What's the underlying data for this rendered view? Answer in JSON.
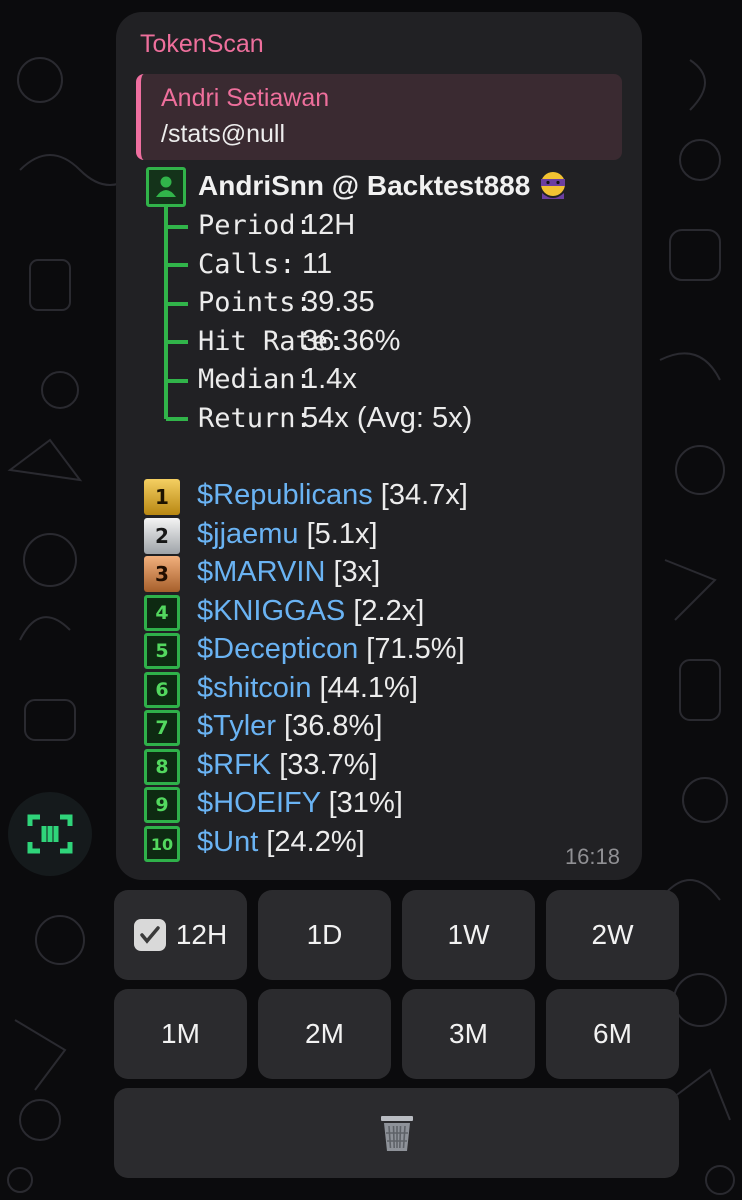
{
  "bubble": {
    "sender": "TokenScan",
    "reply": {
      "name": "Andri Setiawan",
      "text": "/stats@null"
    },
    "header": {
      "title": "AndriSnn @ Backtest888"
    },
    "stats": [
      {
        "label": "Period:",
        "value": "12H"
      },
      {
        "label": "Calls:",
        "value": "11"
      },
      {
        "label": "Points:",
        "value": "39.35"
      },
      {
        "label": "Hit Rate:",
        "value": "36.36%"
      },
      {
        "label": "Median:",
        "value": "1.4x"
      },
      {
        "label": "Return:",
        "value": "54x (Avg: 5x)"
      }
    ],
    "tokens": [
      {
        "rank": "1",
        "name": "$Republicans",
        "mult": "[34.7x]"
      },
      {
        "rank": "2",
        "name": "$jjaemu",
        "mult": "[5.1x]"
      },
      {
        "rank": "3",
        "name": "$MARVIN",
        "mult": "[3x]"
      },
      {
        "rank": "4",
        "name": "$KNIGGAS",
        "mult": "[2.2x]"
      },
      {
        "rank": "5",
        "name": "$Decepticon",
        "mult": "[71.5%]"
      },
      {
        "rank": "6",
        "name": "$shitcoin",
        "mult": "[44.1%]"
      },
      {
        "rank": "7",
        "name": "$Tyler",
        "mult": "[36.8%]"
      },
      {
        "rank": "8",
        "name": "$RFK",
        "mult": "[33.7%]"
      },
      {
        "rank": "9",
        "name": "$HOEIFY",
        "mult": "[31%]"
      },
      {
        "rank": "10",
        "name": "$Unt",
        "mult": "[24.2%]"
      }
    ],
    "time": "16:18"
  },
  "keyboard": {
    "row1": [
      "12H",
      "1D",
      "1W",
      "2W"
    ],
    "row2": [
      "1M",
      "2M",
      "3M",
      "6M"
    ],
    "selected": "12H",
    "delete_icon": "trash-icon"
  },
  "colors": {
    "accent_pink": "#ee6f9c",
    "link_blue": "#6ab3f3",
    "tree_green": "#31b44a",
    "bubble_bg": "#212124",
    "button_bg": "#2b2b2e"
  }
}
